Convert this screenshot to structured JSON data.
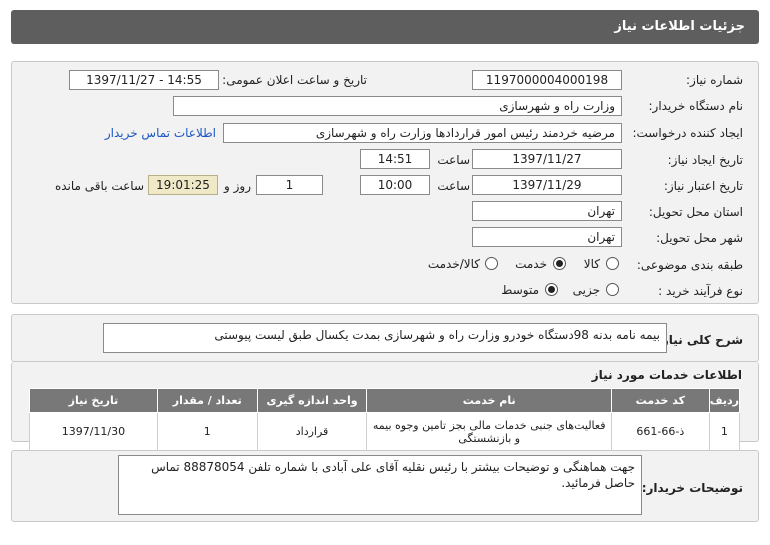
{
  "header": {
    "title": "جزئیات اطلاعات نیاز"
  },
  "form": {
    "need_number_label": "شماره نیاز:",
    "need_number": "1197000004000198",
    "announce_label": "تاریخ و ساعت اعلان عمومی:",
    "announce_value": "1397/11/27 - 14:55",
    "buyer_org_label": "نام دستگاه خریدار:",
    "buyer_org": "وزارت راه و شهرسازی",
    "requester_label": "ایجاد کننده درخواست:",
    "requester": "مرضیه خردمند رئیس امور قراردادها وزارت راه و شهرسازی",
    "contact_link": "اطلاعات تماس خریدار",
    "created_label": "تاریخ ایجاد نیاز:",
    "created_date": "1397/11/27",
    "hour_label": "ساعت",
    "created_time": "14:51",
    "validity_label": "تاریخ اعتبار نیاز:",
    "validity_date": "1397/11/29",
    "validity_time": "10:00",
    "days_value": "1",
    "days_label": "روز و",
    "remaining_time": "19:01:25",
    "remaining_label": "ساعت باقی مانده",
    "province_label": "استان محل تحویل:",
    "province": "تهران",
    "city_label": "شهر محل تحویل:",
    "city": "تهران",
    "category_label": "طبقه بندی موضوعی:",
    "category_options": [
      "کالا",
      "خدمت",
      "کالا/خدمت"
    ],
    "category_selected": "خدمت",
    "process_label": "نوع فرآیند خرید :",
    "process_options": [
      "جزیی",
      "متوسط"
    ],
    "process_selected": "متوسط"
  },
  "summary": {
    "label": "شرح کلی نیاز:",
    "text": "بیمه نامه بدنه 98دستگاه خودرو وزارت راه و شهرسازی بمدت یکسال طبق لیست پیوستی"
  },
  "services": {
    "title": "اطلاعات خدمات مورد نیاز",
    "columns": [
      "ردیف",
      "کد خدمت",
      "نام خدمت",
      "واحد اندازه گیری",
      "تعداد / مقدار",
      "تاریخ نیاز"
    ],
    "rows": [
      {
        "row": "1",
        "code": "ذ-66-661",
        "name": "فعالیت‌های جنبی خدمات مالی بجز تامین وجوه بیمه و بازنشستگی",
        "unit": "قرارداد",
        "qty": "1",
        "date": "1397/11/30"
      }
    ]
  },
  "notes": {
    "label": "توضیحات خریدار:",
    "text": "جهت هماهنگی و توضیحات بیشتر با رئیس نقلیه آقای علی آبادی با شماره تلفن 88878054 تماس حاصل فرمائید."
  }
}
